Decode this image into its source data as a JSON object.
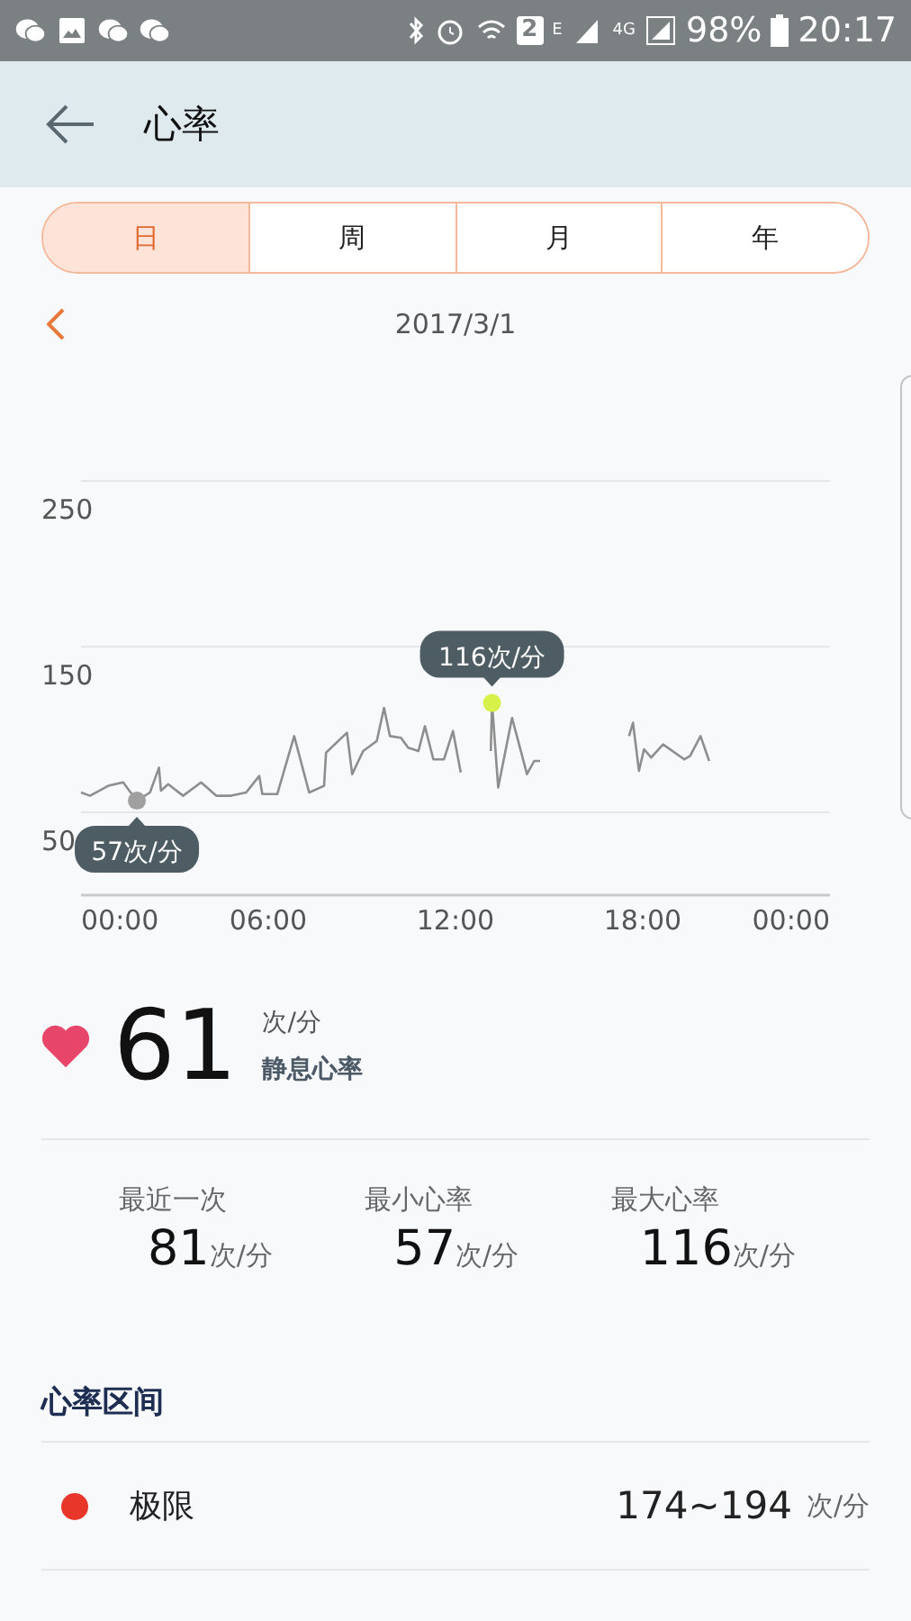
{
  "status_bar": {
    "sim_badge": "2",
    "network_1": "E",
    "network_2": "4G",
    "battery": "98%",
    "time": "20:17"
  },
  "header": {
    "title": "心率"
  },
  "tabs": [
    {
      "label": "日",
      "selected": true
    },
    {
      "label": "周",
      "selected": false
    },
    {
      "label": "月",
      "selected": false
    },
    {
      "label": "年",
      "selected": false
    }
  ],
  "date_nav": {
    "date": "2017/3/1"
  },
  "chart": {
    "chart_data": {
      "type": "line",
      "xlim": [
        0,
        24
      ],
      "ylim": [
        0,
        250
      ],
      "xticks": [
        {
          "value": 0,
          "label": "00:00"
        },
        {
          "value": 6,
          "label": "06:00"
        },
        {
          "value": 12,
          "label": "12:00"
        },
        {
          "value": 18,
          "label": "18:00"
        },
        {
          "value": 24,
          "label": "00:00"
        }
      ],
      "yticks": [
        50,
        150,
        250
      ],
      "x": [
        0,
        0.29,
        0.87,
        1.35,
        1.79,
        2.21,
        2.5,
        2.56,
        2.79,
        3.27,
        3.85,
        4.33,
        4.81,
        5.29,
        5.71,
        5.81,
        6.29,
        6.83,
        7.31,
        7.79,
        7.85,
        8.52,
        8.69,
        9.04,
        9.48,
        9.71,
        9.9,
        10.25,
        10.48,
        10.81,
        11.02,
        11.29,
        11.63,
        11.92,
        12.17,
        13.13,
        13.17,
        13.37,
        13.81,
        14.29,
        14.52,
        14.71,
        17.56,
        17.69,
        17.88,
        18.04,
        18.27,
        18.65,
        19.33,
        19.52,
        19.85,
        20.13
      ],
      "series": [
        {
          "color": "#8e8e8e",
          "values": [
            62,
            60,
            66,
            68,
            57,
            62,
            77,
            63,
            67,
            60,
            68,
            60,
            60,
            62,
            72,
            61,
            61,
            96,
            62,
            66,
            86,
            98,
            73,
            87,
            93,
            113,
            96,
            95,
            89,
            87,
            102,
            82,
            82,
            99,
            74,
            87,
            116,
            65,
            107,
            73,
            81,
            81,
            96,
            104,
            75,
            88,
            83,
            91,
            82,
            84,
            96,
            81
          ]
        }
      ]
    },
    "highlights": [
      {
        "kind": "max",
        "text": "116次/分",
        "color": "#d8f04a"
      },
      {
        "kind": "min",
        "text": "57次/分",
        "color": "#a0a0a0"
      }
    ]
  },
  "resting": {
    "value": "61",
    "unit": "次/分",
    "label": "静息心率"
  },
  "stats": [
    {
      "label": "最近一次",
      "value": "81",
      "unit": "次/分"
    },
    {
      "label": "最小心率",
      "value": "57",
      "unit": "次/分"
    },
    {
      "label": "最大心率",
      "value": "116",
      "unit": "次/分"
    }
  ],
  "zones": {
    "title": "心率区间",
    "items": [
      {
        "name": "极限",
        "color": "#e8372a",
        "range": "174~194",
        "unit": "次/分"
      }
    ]
  }
}
